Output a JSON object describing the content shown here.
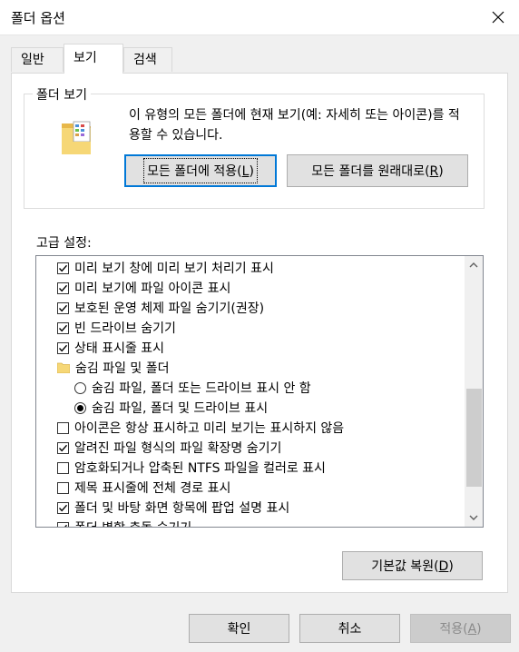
{
  "window": {
    "title": "폴더 옵션"
  },
  "tabs": [
    {
      "label": "일반"
    },
    {
      "label": "보기"
    },
    {
      "label": "검색"
    }
  ],
  "folder_views": {
    "group_label": "폴더 보기",
    "description": "이 유형의 모든 폴더에 현재 보기(예: 자세히 또는 아이콘)를 적용할 수 있습니다.",
    "apply_button": {
      "label_pre": "모든 폴더에 적용(",
      "accel": "L",
      "label_post": ")"
    },
    "reset_button": {
      "label_pre": "모든 폴더를 원래대로(",
      "accel": "R",
      "label_post": ")"
    }
  },
  "advanced": {
    "label": "고급 설정:",
    "items": [
      {
        "type": "checkbox",
        "checked": true,
        "label": "미리 보기 창에 미리 보기 처리기 표시"
      },
      {
        "type": "checkbox",
        "checked": true,
        "label": "미리 보기에 파일 아이콘 표시"
      },
      {
        "type": "checkbox",
        "checked": true,
        "label": "보호된 운영 체제 파일 숨기기(권장)"
      },
      {
        "type": "checkbox",
        "checked": true,
        "label": "빈 드라이브 숨기기"
      },
      {
        "type": "checkbox",
        "checked": true,
        "label": "상태 표시줄 표시"
      },
      {
        "type": "folder",
        "label": "숨김 파일 및 폴더"
      },
      {
        "type": "radio",
        "checked": false,
        "label": "숨김 파일, 폴더 또는 드라이브 표시 안 함"
      },
      {
        "type": "radio",
        "checked": true,
        "label": "숨김 파일, 폴더 및 드라이브 표시"
      },
      {
        "type": "checkbox",
        "checked": false,
        "label": "아이콘은 항상 표시하고 미리 보기는 표시하지 않음"
      },
      {
        "type": "checkbox",
        "checked": true,
        "label": "알려진 파일 형식의 파일 확장명 숨기기"
      },
      {
        "type": "checkbox",
        "checked": false,
        "label": "암호화되거나 압축된 NTFS 파일을 컬러로 표시"
      },
      {
        "type": "checkbox",
        "checked": false,
        "label": "제목 표시줄에 전체 경로 표시"
      },
      {
        "type": "checkbox",
        "checked": true,
        "label": "폴더 및 바탕 화면 항목에 팝업 설명 표시"
      },
      {
        "type": "checkbox",
        "checked": true,
        "label": "폴더 병합 충돌 숨기기"
      }
    ],
    "restore_button": {
      "label_pre": "기본값 복원(",
      "accel": "D",
      "label_post": ")"
    }
  },
  "footer": {
    "ok": {
      "label": "확인"
    },
    "cancel": {
      "label": "취소"
    },
    "apply": {
      "label_pre": "적용(",
      "accel": "A",
      "label_post": ")"
    }
  },
  "colors": {
    "accent": "#0078d7",
    "folder": "#f6d776",
    "thumb": "#cdcdcd"
  },
  "icons": {
    "close": "close-icon",
    "folder": "folder-icon",
    "checkbox": "checkmark-icon"
  }
}
